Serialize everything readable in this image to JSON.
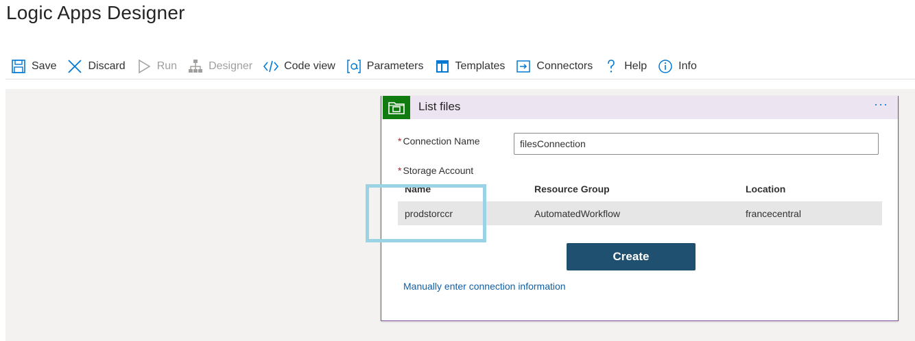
{
  "page": {
    "title": "Logic Apps Designer"
  },
  "toolbar": {
    "items": [
      {
        "label": "Save",
        "icon": "save-icon",
        "disabled": false
      },
      {
        "label": "Discard",
        "icon": "close-icon",
        "disabled": false
      },
      {
        "label": "Run",
        "icon": "play-icon",
        "disabled": true
      },
      {
        "label": "Designer",
        "icon": "sitemap-icon",
        "disabled": true
      },
      {
        "label": "Code view",
        "icon": "code-icon",
        "disabled": false
      },
      {
        "label": "Parameters",
        "icon": "parameters-icon",
        "disabled": false
      },
      {
        "label": "Templates",
        "icon": "templates-icon",
        "disabled": false
      },
      {
        "label": "Connectors",
        "icon": "connectors-icon",
        "disabled": false
      },
      {
        "label": "Help",
        "icon": "question-icon",
        "disabled": false
      },
      {
        "label": "Info",
        "icon": "info-icon",
        "disabled": false
      }
    ]
  },
  "card": {
    "title": "List files",
    "more": "···",
    "connection_name_label": "Connection Name",
    "connection_name_value": "filesConnection",
    "storage_account_label": "Storage Account",
    "table": {
      "columns": [
        "Name",
        "Resource Group",
        "Location"
      ],
      "rows": [
        [
          "prodstorccr",
          "AutomatedWorkflow",
          "francecentral"
        ]
      ]
    },
    "create_label": "Create",
    "manual_link": "Manually enter connection information"
  },
  "colors": {
    "accent": "#0078d4",
    "card_header": "#ede4f1",
    "card_border": "#7d4d9c",
    "connector_icon_bg": "#107c10",
    "create_button": "#1f5070",
    "highlight": "#9ad4e4"
  }
}
